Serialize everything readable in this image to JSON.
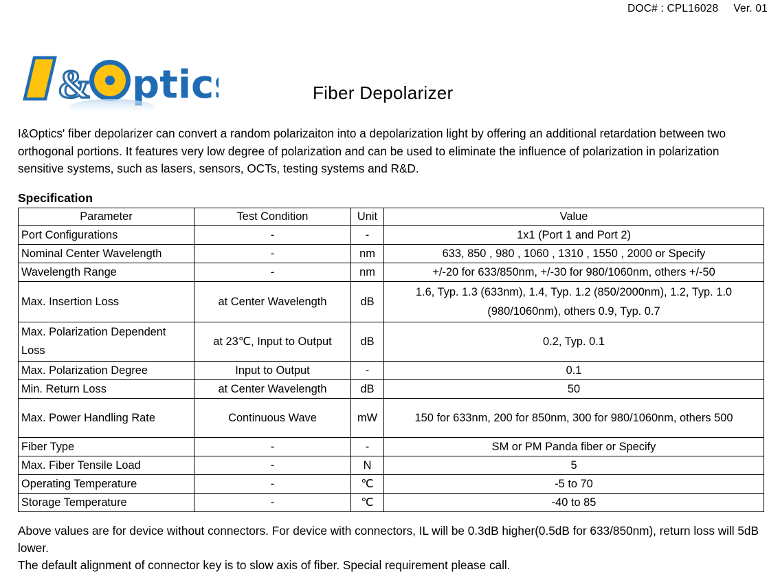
{
  "header": {
    "doc_number": "DOC# : CPL16028",
    "version": "Ver. 01"
  },
  "logo": {
    "text": "I&Optics",
    "colors": {
      "blue": "#1f6cb5",
      "yellow": "#ffc20e"
    }
  },
  "title": "Fiber Depolarizer",
  "intro": "I&Optics' fiber depolarizer can convert a random polarizaiton into a depolarization light by offering an additional retardation between two orthogonal portions. It features very low degree of polarization and can be used to eliminate the influence of polarization in polarization sensitive systems, such as lasers, sensors, OCTs, testing systems and R&D.",
  "spec_heading": "Specification",
  "table": {
    "columns": [
      "Parameter",
      "Test Condition",
      "Unit",
      "Value"
    ],
    "rows": [
      {
        "parameter": "Port Configurations",
        "condition": "-",
        "unit": "-",
        "value": "1x1 (Port 1 and Port 2)"
      },
      {
        "parameter": "Nominal Center Wavelength",
        "condition": "-",
        "unit": "nm",
        "value": "633, 850 , 980 , 1060 , 1310 , 1550 , 2000 or Specify"
      },
      {
        "parameter": "Wavelength Range",
        "condition": "-",
        "unit": "nm",
        "value": "+/-20 for 633/850nm, +/-30 for 980/1060nm, others +/-50"
      },
      {
        "parameter": "Max. Insertion Loss",
        "condition": "at Center Wavelength",
        "unit": "dB",
        "value": "1.6, Typ. 1.3 (633nm), 1.4, Typ. 1.2 (850/2000nm), 1.2, Typ. 1.0 (980/1060nm), others 0.9, Typ. 0.7"
      },
      {
        "parameter": "Max. Polarization Dependent Loss",
        "condition": "at 23℃, Input to Output",
        "unit": "dB",
        "value": "0.2, Typ. 0.1"
      },
      {
        "parameter": "Max. Polarization Degree",
        "condition": "Input to Output",
        "unit": "-",
        "value": "0.1"
      },
      {
        "parameter": "Min. Return Loss",
        "condition": "at Center Wavelength",
        "unit": "dB",
        "value": "50"
      },
      {
        "parameter": "Max. Power Handling Rate",
        "condition": "Continuous Wave",
        "unit": "mW",
        "value": "150 for 633nm, 200 for 850nm, 300 for 980/1060nm, others 500"
      },
      {
        "parameter": "Fiber Type",
        "condition": "-",
        "unit": "-",
        "value": "SM or PM Panda fiber or Specify"
      },
      {
        "parameter": "Max. Fiber Tensile Load",
        "condition": "-",
        "unit": "N",
        "value": "5"
      },
      {
        "parameter": "Operating Temperature",
        "condition": "-",
        "unit": "℃",
        "value": "-5 to 70"
      },
      {
        "parameter": "Storage Temperature",
        "condition": "-",
        "unit": "℃",
        "value": "-40 to 85"
      }
    ]
  },
  "notes": [
    "Above values are for device without connectors. For device with connectors, IL will be 0.3dB higher(0.5dB for 633/850nm), return loss will 5dB lower.",
    "The default alignment of connector key is to slow axis of fiber. Special requirement please call."
  ]
}
